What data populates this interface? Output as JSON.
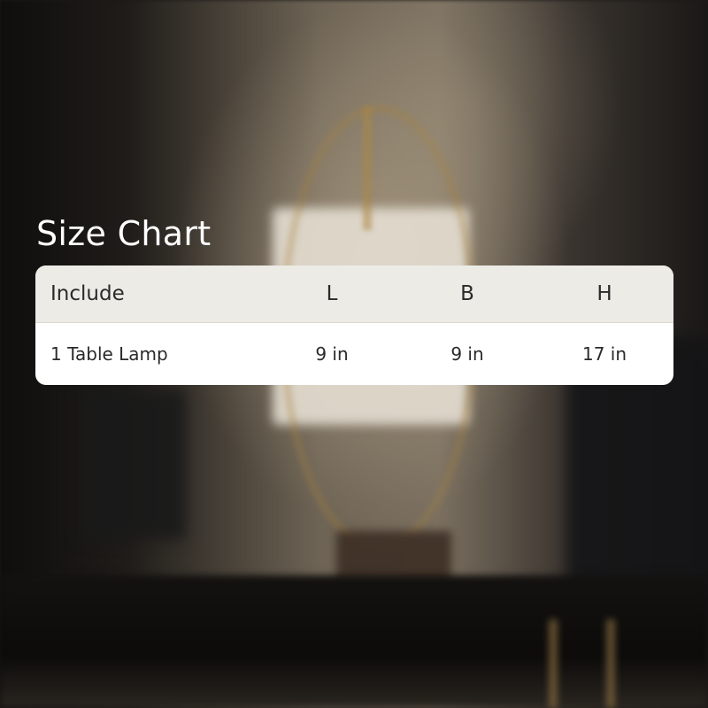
{
  "title": "Size Chart",
  "table": {
    "headers": [
      "Include",
      "L",
      "B",
      "H"
    ],
    "rows": [
      [
        "1 Table Lamp",
        "9 in",
        "9 in",
        "17 in"
      ]
    ]
  }
}
